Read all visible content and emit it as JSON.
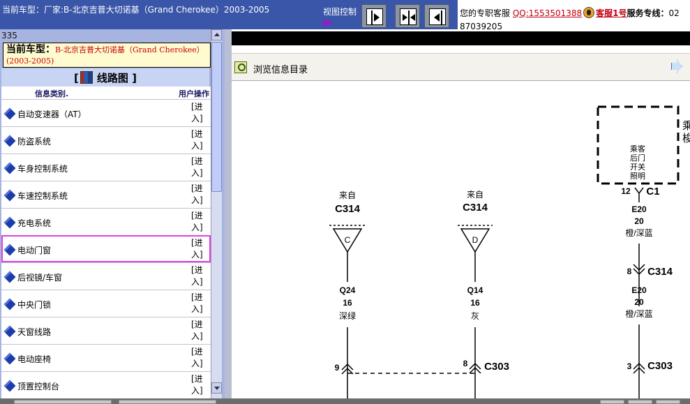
{
  "header": {
    "model_title": "当前车型：厂家:B-北京吉普大切诺基（Grand Cherokee）2003-2005",
    "view_control_label": "视图控制",
    "contact_prefix": "您的专职客服",
    "qq": "QQ:1553501388",
    "service_name": "客服1号",
    "hotline_label": "服务专线：",
    "hotline_partial": "02",
    "phone_line2": "87039205"
  },
  "left_panel": {
    "catalog_no": "335",
    "model_label": "当前车型：",
    "model_value": "B-北京吉普大切诺基（Grand Cherokee）(2003-2005)",
    "section_title": "线路图",
    "col_category": "信息类别.",
    "col_action": "用户操作",
    "enter_label": "[进入]",
    "items": [
      {
        "label": "自动变速器（AT）"
      },
      {
        "label": "防盗系统"
      },
      {
        "label": "车身控制系统"
      },
      {
        "label": "车速控制系统"
      },
      {
        "label": "充电系统"
      },
      {
        "label": "电动门窗"
      },
      {
        "label": "后视镜/车窗"
      },
      {
        "label": "中央门锁"
      },
      {
        "label": "天窗线路"
      },
      {
        "label": "电动座椅"
      },
      {
        "label": "顶置控制台"
      }
    ],
    "selected_index": 5
  },
  "right_panel": {
    "browse_label": "浏览信息目录"
  },
  "diagram": {
    "from_label": "来自",
    "left_connector": {
      "src": "C314",
      "pin": "C",
      "circuit": "Q24",
      "gauge": "16",
      "color": "深绿",
      "cavity": "9"
    },
    "mid_connector": {
      "src": "C314",
      "pin": "D",
      "circuit": "Q14",
      "gauge": "16",
      "color": "灰",
      "cavity": "8",
      "conn": "C303"
    },
    "component_name": "乘客后门开关照明",
    "component_lines": [
      "乘客",
      "后门",
      "开关",
      "照明"
    ],
    "right_chain": {
      "c1_pin": "12",
      "c1": "C1",
      "circuit1": "E20",
      "gauge1": "20",
      "color1": "橙/深蓝",
      "c314_pin": "8",
      "c314": "C314",
      "circuit2": "E20",
      "gauge2": "20",
      "color2": "橙/深蓝",
      "c303_pin": "3",
      "c303": "C303"
    },
    "edge_text": [
      "乘",
      "梭"
    ]
  }
}
